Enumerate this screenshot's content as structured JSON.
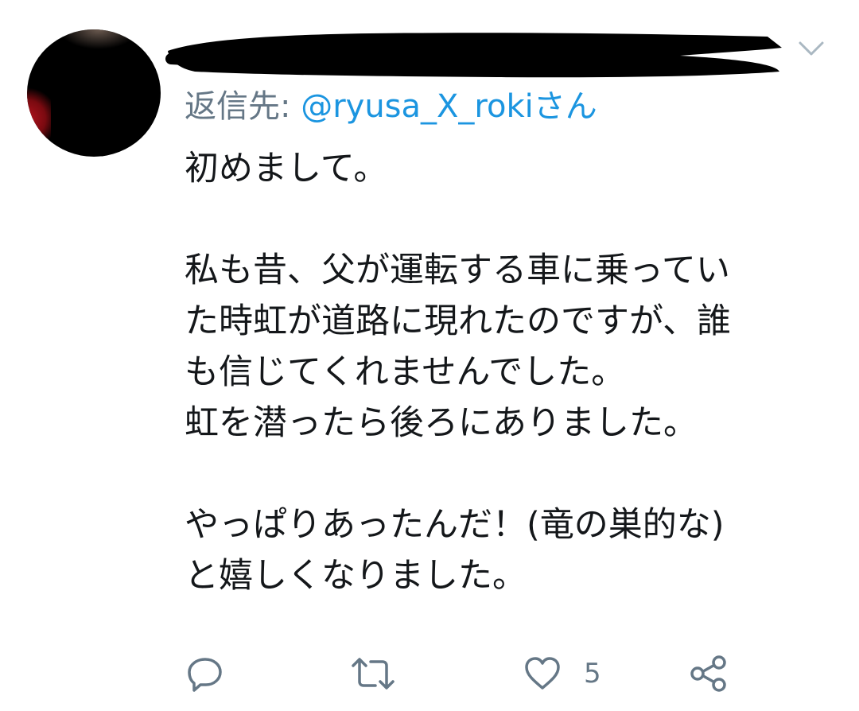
{
  "tweet": {
    "reply_prefix": "返信先: ",
    "reply_mention": "@ryusa_X_roki",
    "reply_suffix": "さん",
    "lines": [
      "初めまして。",
      "",
      "私も昔、父が運転する車に乗ってい",
      "た時虹が道路に現れたのですが、誰",
      "も信じてくれませんでした。",
      "虹を潜ったら後ろにありました。",
      "",
      "やっぱりあったんだ！(竜の巣的な)",
      "と嬉しくなりました。"
    ]
  },
  "actions": {
    "reply_icon": "reply-icon",
    "retweet_icon": "retweet-icon",
    "like_icon": "heart-icon",
    "like_count": "5",
    "share_icon": "share-icon"
  },
  "colors": {
    "text": "#14171a",
    "secondary": "#657786",
    "link": "#1b95e0",
    "redaction": "#000000"
  }
}
